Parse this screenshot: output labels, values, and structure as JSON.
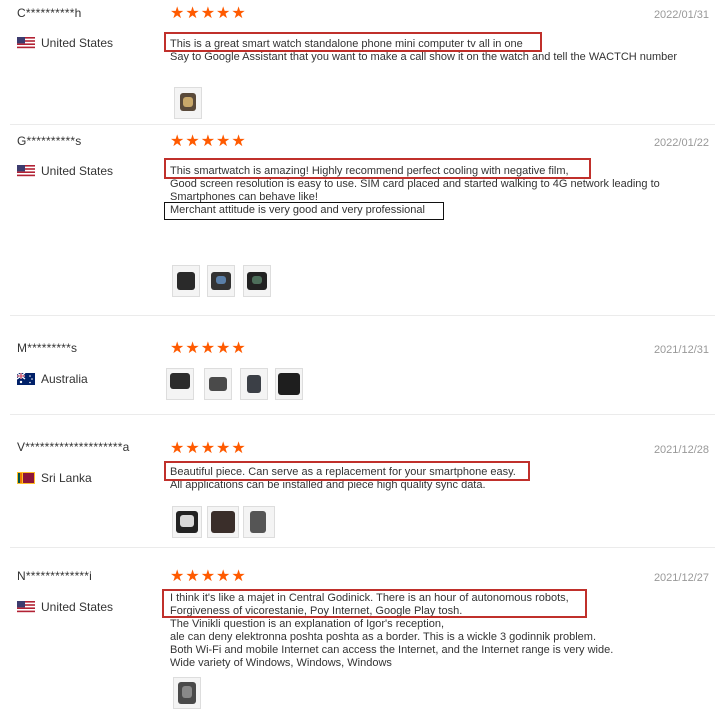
{
  "reviews": [
    {
      "user": "C**********h",
      "country": "United States",
      "flag": "us-flag",
      "stars": "★★★★★",
      "date": "2022/01/31",
      "lines": [
        "This is a great smart watch standalone phone mini computer tv all in one",
        "Say to Google Assistant that you want to make a call show it on the watch and tell the WACTCH number"
      ]
    },
    {
      "user": "G**********s",
      "country": "United States",
      "flag": "us-flag",
      "stars": "★★★★★",
      "date": "2022/01/22",
      "lines": [
        "This smartwatch is amazing! Highly recommend perfect cooling with negative film,",
        "Good screen resolution is easy to use. SIM card placed and started walking to 4G network leading to",
        "Smartphones can behave like!",
        "Merchant attitude is very good and very professional"
      ]
    },
    {
      "user": "M*********s",
      "country": "Australia",
      "flag": "au-flag",
      "stars": "★★★★★",
      "date": "2021/12/31",
      "lines": []
    },
    {
      "user": "V********************a",
      "country": "Sri Lanka",
      "flag": "lk-flag",
      "stars": "★★★★★",
      "date": "2021/12/28",
      "lines": [
        "Beautiful piece. Can serve as a replacement for your smartphone easy.",
        "All applications can be installed and piece high quality sync data."
      ]
    },
    {
      "user": "N*************i",
      "country": "United States",
      "flag": "us-flag",
      "stars": "★★★★★",
      "date": "2021/12/27",
      "lines": [
        "I think it's like a majet in Central Godinick. There is an hour of autonomous robots,",
        "Forgiveness of vicorestanie, Poy Internet, Google Play tosh.",
        "The Vinikli question is an explanation of Igor's reception,",
        "ale can deny elektronna poshta poshta as a border. This is a wickle 3 godinnik problem.",
        "Both Wi-Fi and mobile Internet can access the Internet, and the Internet range is very wide.",
        "Wide variety of Windows, Windows, Windows"
      ]
    }
  ],
  "colors": {
    "star": "#ff5a00",
    "highlight_box": "#c0302b",
    "date": "#999999"
  }
}
